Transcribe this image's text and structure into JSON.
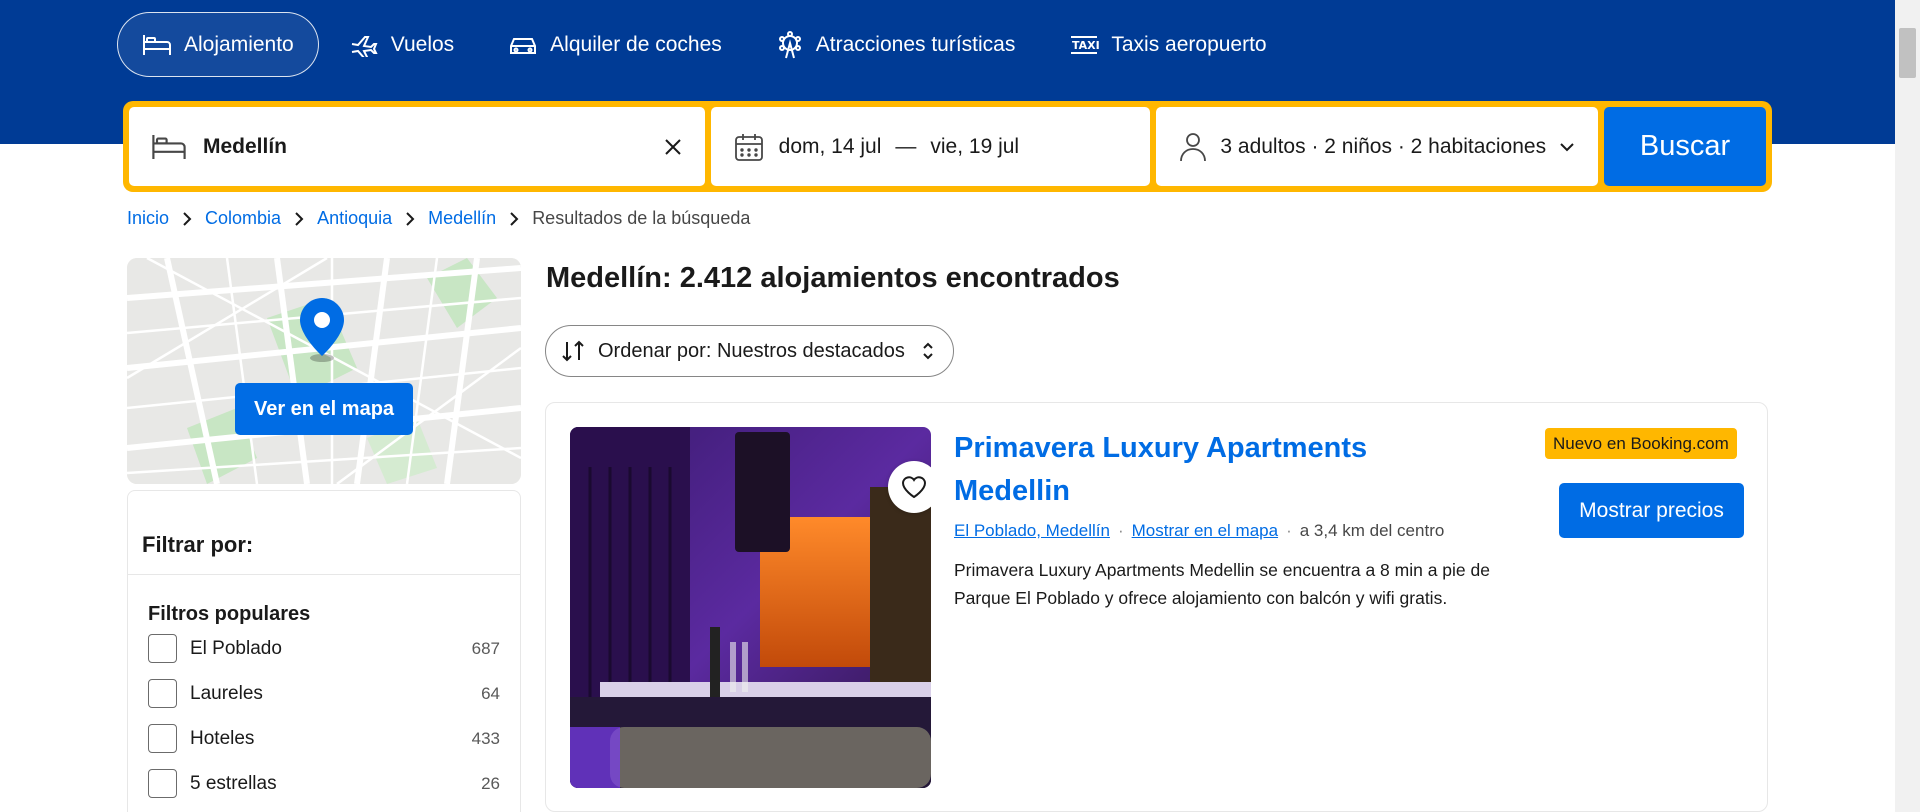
{
  "nav": {
    "items": [
      {
        "label": "Alojamiento",
        "icon": "bed-icon",
        "active": true
      },
      {
        "label": "Vuelos",
        "icon": "plane-icon"
      },
      {
        "label": "Alquiler de coches",
        "icon": "car-icon"
      },
      {
        "label": "Atracciones turísticas",
        "icon": "attractions-icon"
      },
      {
        "label": "Taxis aeropuerto",
        "icon": "taxi-icon"
      }
    ]
  },
  "search": {
    "destination": "Medellín",
    "checkin": "dom, 14 jul",
    "date_separator": "—",
    "checkout": "vie, 19 jul",
    "guests": "3 adultos · 2 niños · 2 habitaciones",
    "button": "Buscar"
  },
  "breadcrumb": {
    "items": [
      "Inicio",
      "Colombia",
      "Antioquia",
      "Medellín"
    ],
    "current": "Resultados de la búsqueda"
  },
  "map": {
    "button": "Ver en el mapa"
  },
  "filters": {
    "title": "Filtrar por:",
    "section": "Filtros populares",
    "items": [
      {
        "label": "El Poblado",
        "count": "687"
      },
      {
        "label": "Laureles",
        "count": "64"
      },
      {
        "label": "Hoteles",
        "count": "433"
      },
      {
        "label": "5 estrellas",
        "count": "26"
      }
    ]
  },
  "results": {
    "title": "Medellín: 2.412 alojamientos encontrados",
    "sort": "Ordenar por: Nuestros destacados"
  },
  "property": {
    "name": "Primavera Luxury Apartments Medellin",
    "location": "El Poblado, Medellín",
    "map_link": "Mostrar en el mapa",
    "distance": "a 3,4 km del centro",
    "description": "Primavera Luxury Apartments Medellin se encuentra a 8 min a pie de Parque El Poblado y ofrece alojamiento con balcón y wifi gratis.",
    "badge": "Nuevo en Booking.com",
    "price_button": "Mostrar precios"
  },
  "colors": {
    "header": "#003b95",
    "accent": "#006ce4",
    "searchbar": "#ffb700"
  }
}
